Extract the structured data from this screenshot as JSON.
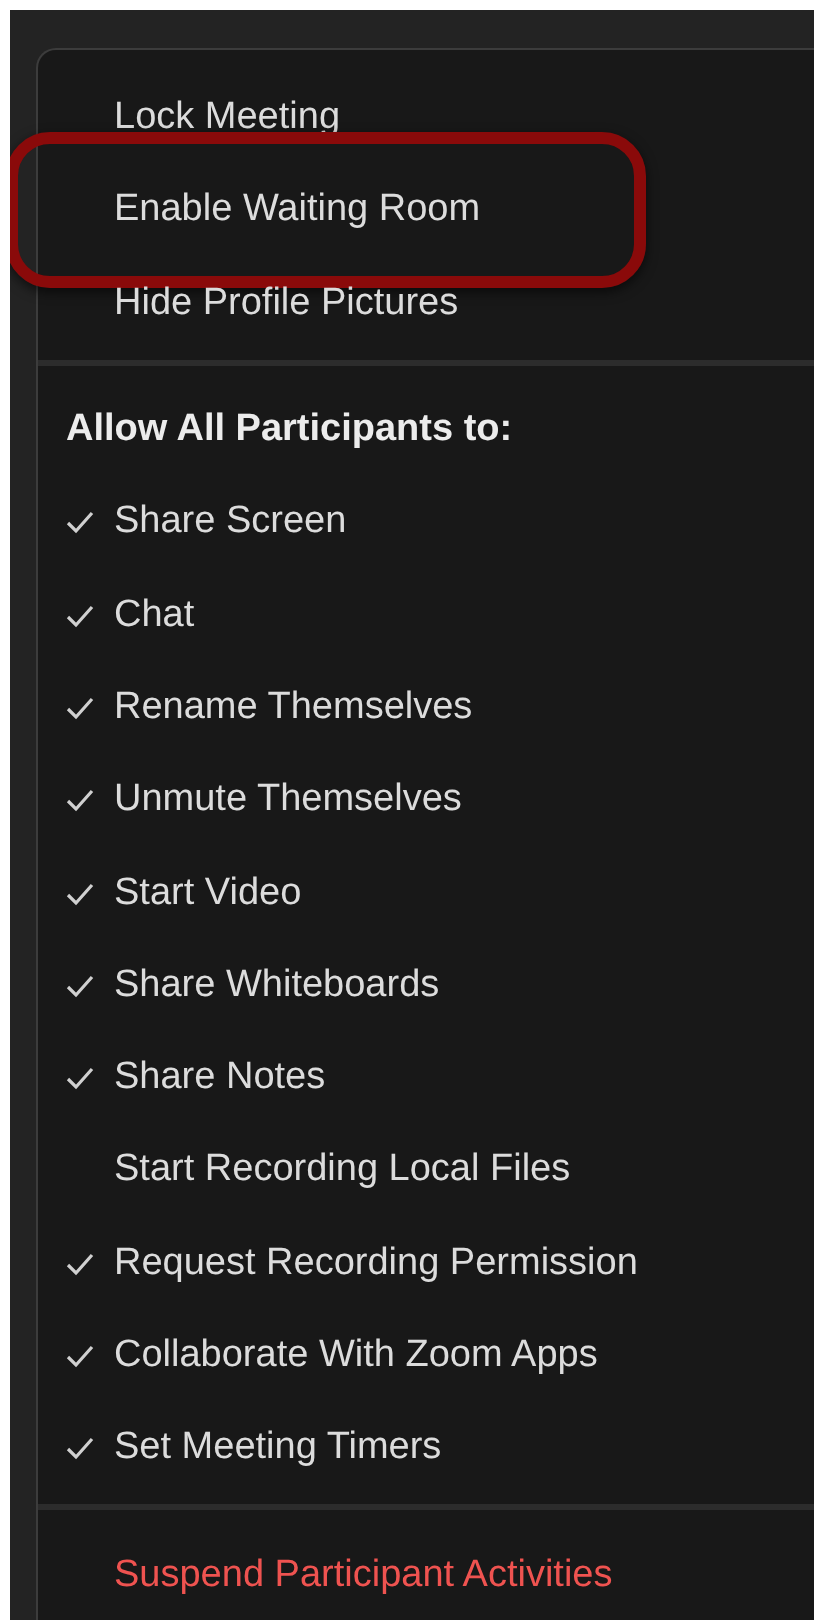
{
  "menu": {
    "top_items": [
      {
        "label": "Lock Meeting"
      },
      {
        "label": "Enable Waiting Room",
        "highlighted": true
      },
      {
        "label": "Hide Profile Pictures"
      }
    ],
    "section_title": "Allow All Participants to:",
    "permissions": [
      {
        "label": "Share Screen",
        "checked": true
      },
      {
        "label": "Chat",
        "checked": true
      },
      {
        "label": "Rename Themselves",
        "checked": true
      },
      {
        "label": "Unmute Themselves",
        "checked": true
      },
      {
        "label": "Start Video",
        "checked": true
      },
      {
        "label": "Share Whiteboards",
        "checked": true
      },
      {
        "label": "Share Notes",
        "checked": true
      },
      {
        "label": "Start Recording Local Files",
        "checked": false
      },
      {
        "label": "Request Recording Permission",
        "checked": true
      },
      {
        "label": "Collaborate With Zoom Apps",
        "checked": true
      },
      {
        "label": "Set Meeting Timers",
        "checked": true
      }
    ],
    "danger_item": {
      "label": "Suspend Participant Activities"
    }
  }
}
